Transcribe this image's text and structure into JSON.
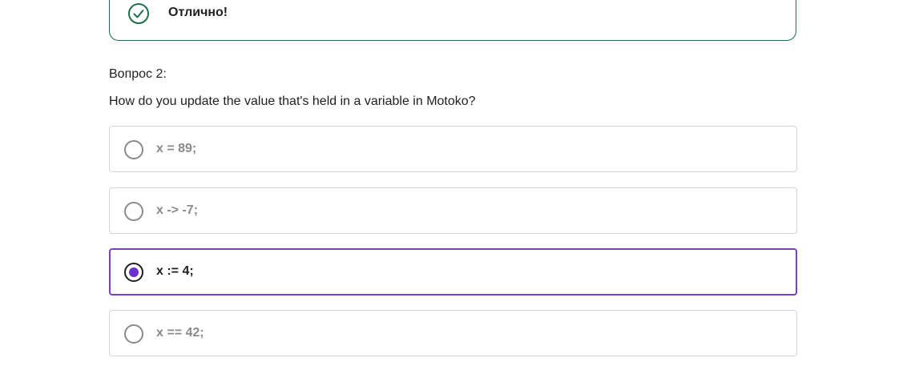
{
  "feedback": {
    "icon": "check-circle-icon",
    "text": "Отлично!",
    "color": "#1f6f4a"
  },
  "question": {
    "number_label": "Вопрос 2:",
    "text": "How do you update the value that's held in a variable in Motoko?",
    "options": [
      {
        "label": "x = 89;",
        "selected": false
      },
      {
        "label": "x -> -7;",
        "selected": false
      },
      {
        "label": "x := 4;",
        "selected": true
      },
      {
        "label": "x == 42;",
        "selected": false
      }
    ],
    "accent_color": "#7a3fc7"
  }
}
